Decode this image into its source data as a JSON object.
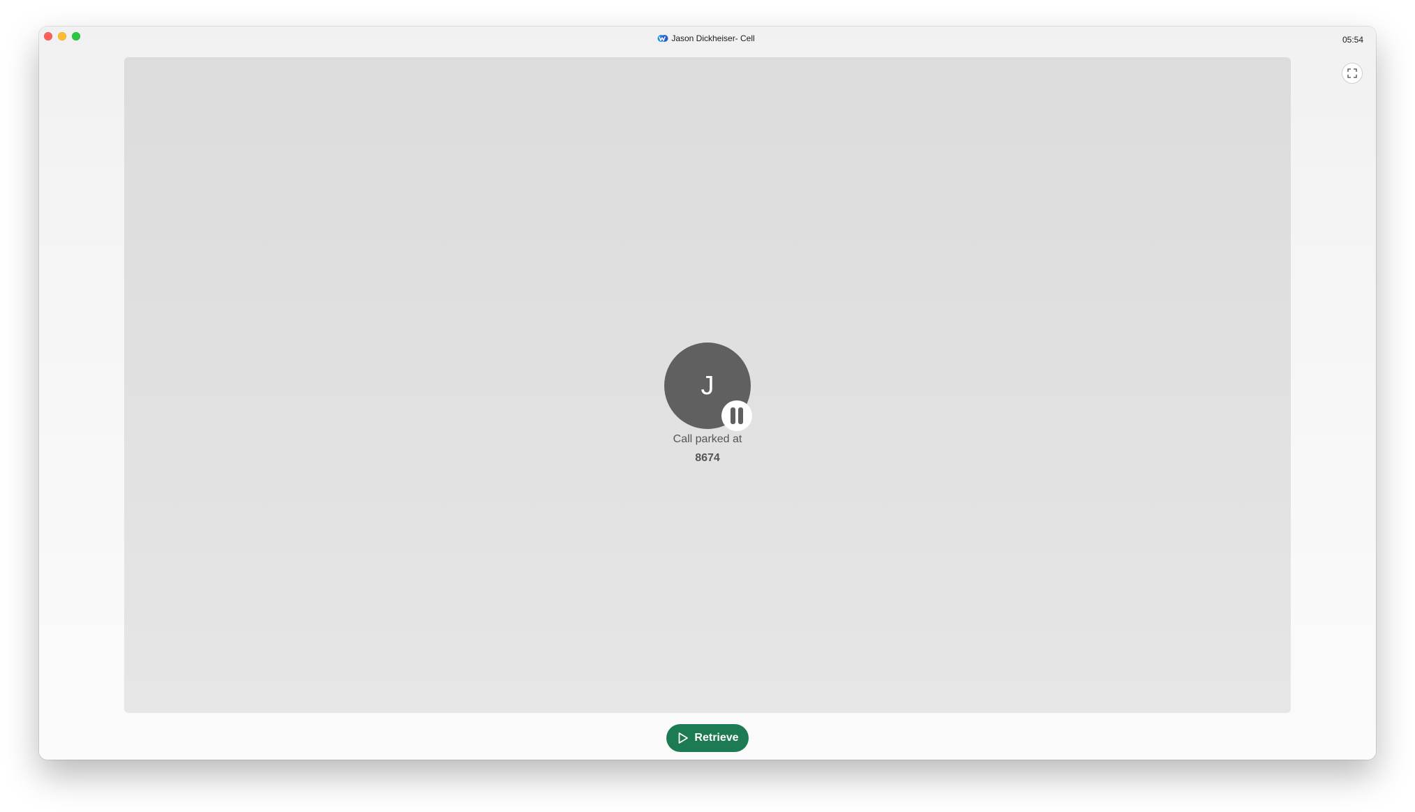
{
  "window": {
    "title": "Jason Dickheiser- Cell",
    "clock": "05:54"
  },
  "call": {
    "avatar_initial": "J",
    "status_label": "Call parked at",
    "park_number": "8674"
  },
  "actions": {
    "retrieve_label": "Retrieve"
  },
  "icons": {
    "app": "webex-logo-icon",
    "fullscreen": "fullscreen-icon",
    "pause": "pause-icon",
    "play": "play-icon"
  },
  "colors": {
    "accent_green": "#1d7b53",
    "avatar_bg": "#606060",
    "close": "#fe5f57",
    "minimize": "#febc2e",
    "zoom": "#28c840"
  }
}
